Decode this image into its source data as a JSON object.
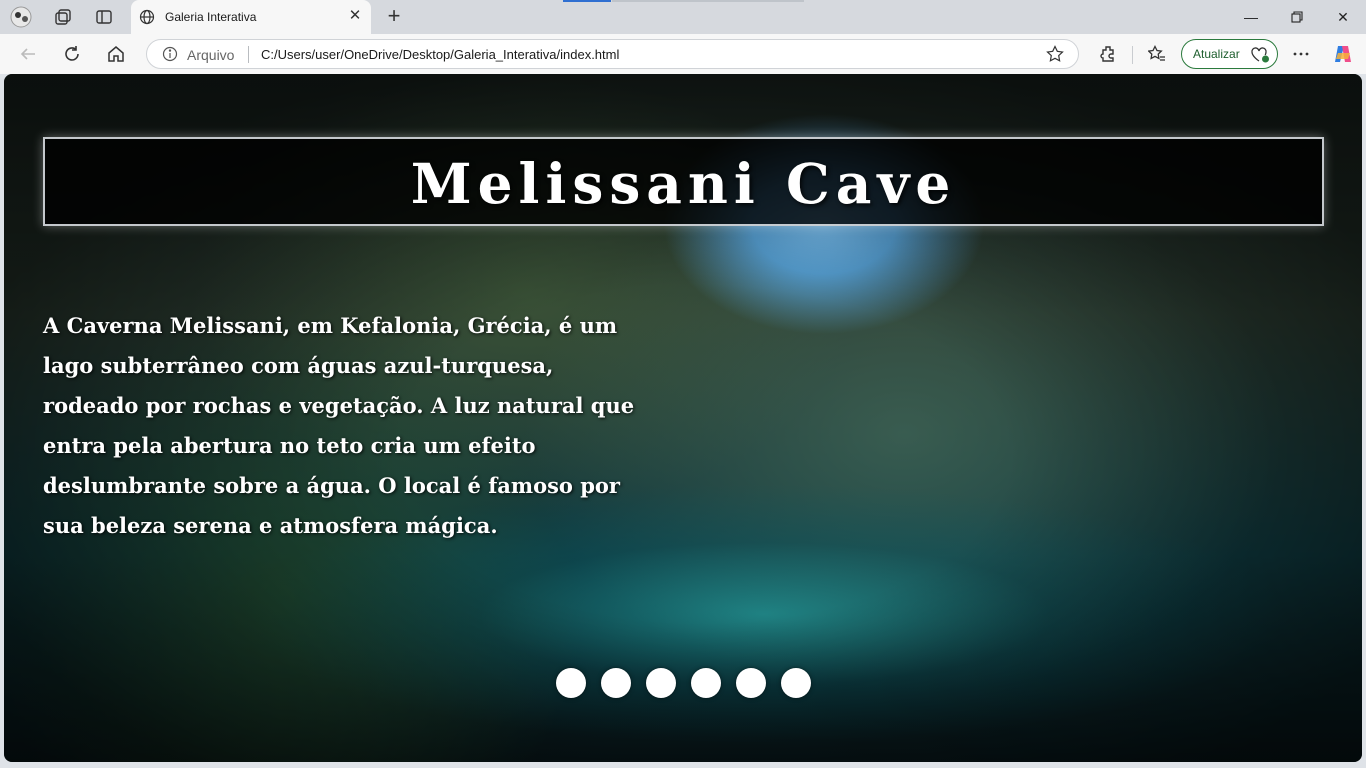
{
  "browser": {
    "tab": {
      "title": "Galeria Interativa",
      "close_icon": "close-icon"
    },
    "address": {
      "source_label": "Arquivo",
      "url": "C:/Users/user/OneDrive/Desktop/Galeria_Interativa/index.html"
    },
    "update_button": {
      "label": "Atualizar"
    },
    "accent_color": "#2b7a3d"
  },
  "page": {
    "title": "Melissani Cave",
    "description": "A Caverna Melissani, em Kefalonia, Grécia, é um lago subterrâneo com águas azul-turquesa, rodeado por rochas e vegetação. A luz natural que entra pela abertura no teto cria um efeito deslumbrante sobre a água. O local é famoso por sua beleza serena e atmosfera mágica.",
    "slide_count": 6
  }
}
